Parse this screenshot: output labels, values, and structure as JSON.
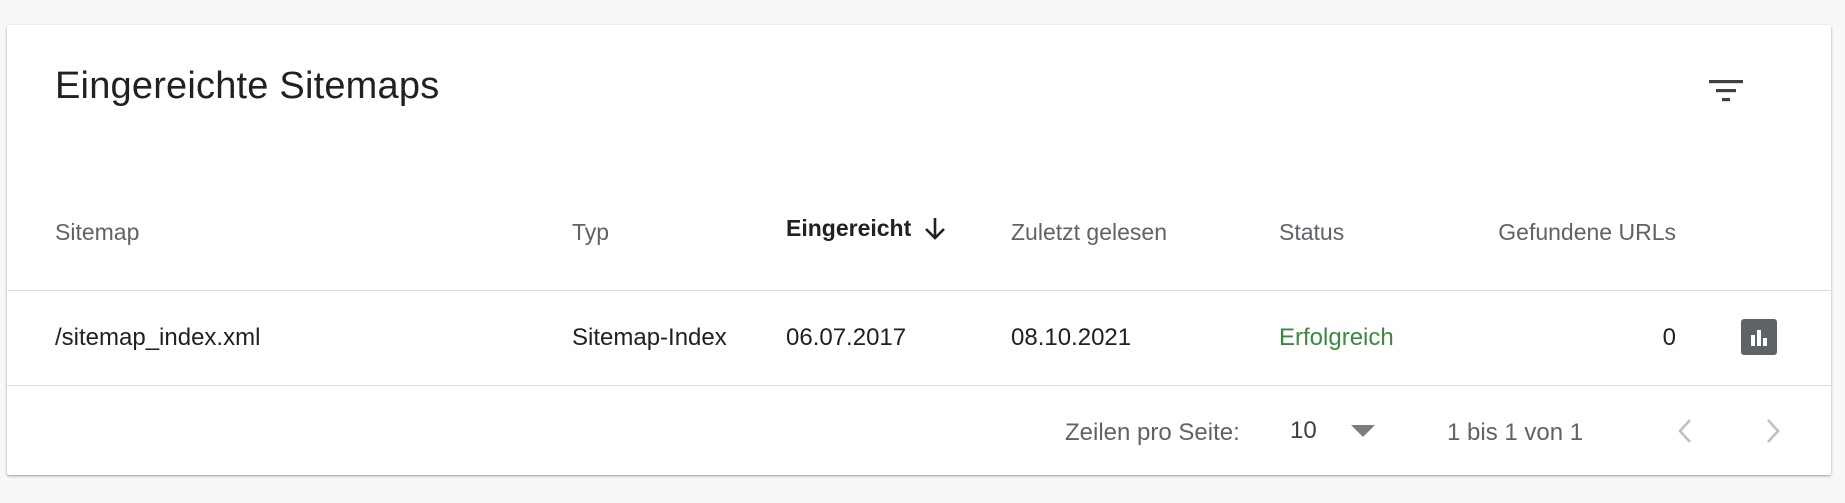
{
  "card": {
    "title": "Eingereichte Sitemaps",
    "filter_icon": "filter-list-icon"
  },
  "table": {
    "columns": [
      "Sitemap",
      "Typ",
      "Eingereicht",
      "Zuletzt gelesen",
      "Status",
      "Gefundene URLs"
    ],
    "sort_column": "Eingereicht",
    "sort_direction": "descending",
    "sort_icon": "arrow-downward-icon",
    "rows": [
      {
        "sitemap": "/sitemap_index.xml",
        "type": "Sitemap-Index",
        "submitted": "06.07.2017",
        "last_read": "08.10.2021",
        "status": "Erfolgreich",
        "urls": "0",
        "report_icon": "bar-chart-icon"
      }
    ]
  },
  "pagination": {
    "rows_label": "Zeilen pro Seite:",
    "rows_value": "10",
    "range_text": "1 bis 1 von 1",
    "prev_icon": "chevron-left-icon",
    "next_icon": "chevron-right-icon"
  },
  "colors": {
    "status_success": "#3c8a3f",
    "report_button_bg": "#5f6368",
    "header_text": "#5f6368",
    "body_text": "#202124"
  }
}
